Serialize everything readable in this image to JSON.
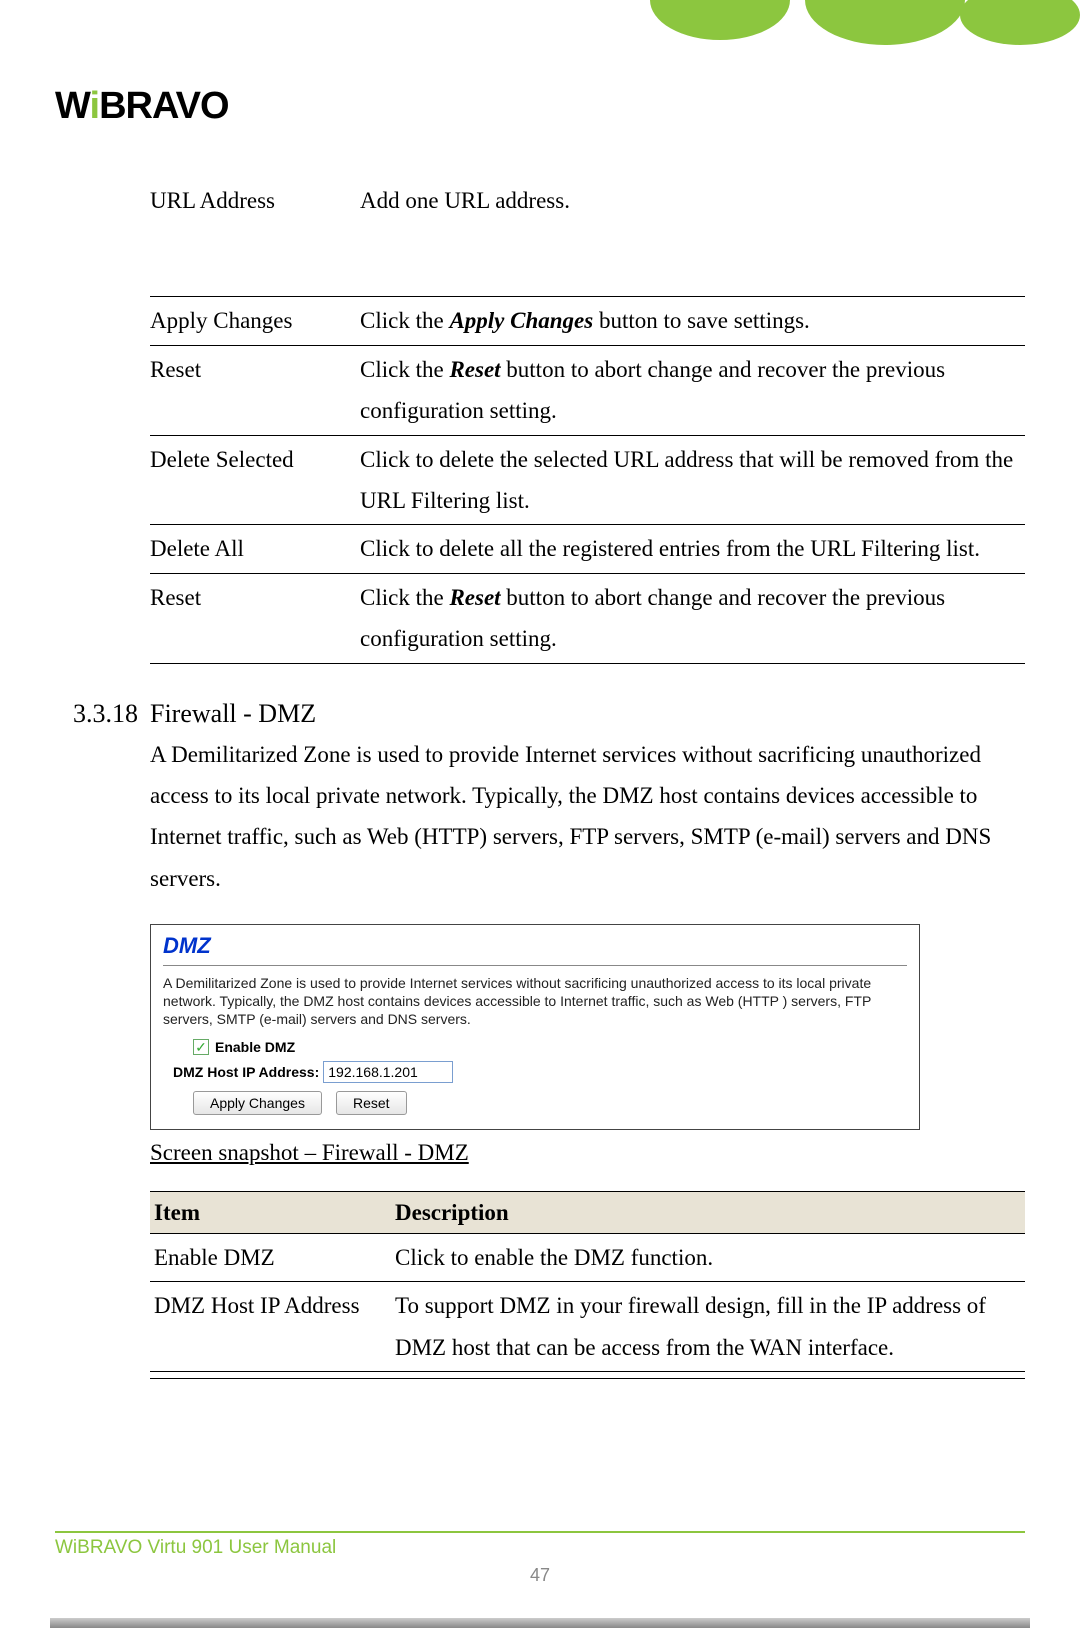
{
  "logo": {
    "part1": "W",
    "part2": "i",
    "part3": "BRAVO"
  },
  "intro_row": {
    "left": "URL Address",
    "right": "Add one URL address."
  },
  "table1": [
    {
      "left": "Apply Changes",
      "right_pre": "Click the ",
      "right_em": "Apply Changes",
      "right_post": " button to save settings."
    },
    {
      "left": "Reset",
      "right_pre": "Click the ",
      "right_em": "Reset",
      "right_post": " button to abort change and recover the previous configuration setting."
    },
    {
      "left": "Delete Selected",
      "right_plain": "Click to delete the selected URL address that will be removed from the URL Filtering list."
    },
    {
      "left": "Delete All",
      "right_plain": "Click to delete all the registered entries from the URL Filtering list."
    },
    {
      "left": "Reset",
      "right_pre": "Click the ",
      "right_em": "Reset",
      "right_post": " button to abort change and recover the previous configuration setting."
    }
  ],
  "section": {
    "number": "3.3.18",
    "title": "Firewall - DMZ",
    "body": "A Demilitarized Zone is used to provide Internet services without sacrificing unauthorized access to its local private network. Typically, the DMZ host contains devices accessible to Internet traffic, such as Web (HTTP) servers, FTP servers, SMTP (e-mail) servers and DNS servers."
  },
  "snapshot": {
    "title": "DMZ",
    "desc": "A Demilitarized Zone is used to provide Internet services without sacrificing unauthorized access to its local private network. Typically, the DMZ host contains devices accessible to Internet traffic, such as Web (HTTP ) servers, FTP servers, SMTP (e-mail) servers and DNS servers.",
    "enable_label": "Enable DMZ",
    "enable_checked": true,
    "ip_label": "DMZ Host IP Address:",
    "ip_value": "192.168.1.201",
    "btn_apply": "Apply Changes",
    "btn_reset": "Reset"
  },
  "caption": "Screen snapshot – Firewall - DMZ",
  "table2": {
    "head_left": "Item",
    "head_right": "Description",
    "rows": [
      {
        "left": "Enable DMZ",
        "right": "Click to enable the DMZ function."
      },
      {
        "left": "DMZ Host IP Address",
        "right": "To support DMZ in your firewall design, fill in the IP address of DMZ host that can be access from the WAN interface."
      }
    ]
  },
  "footer": {
    "text": "WiBRAVO Virtu 901 User Manual",
    "page": "47"
  }
}
